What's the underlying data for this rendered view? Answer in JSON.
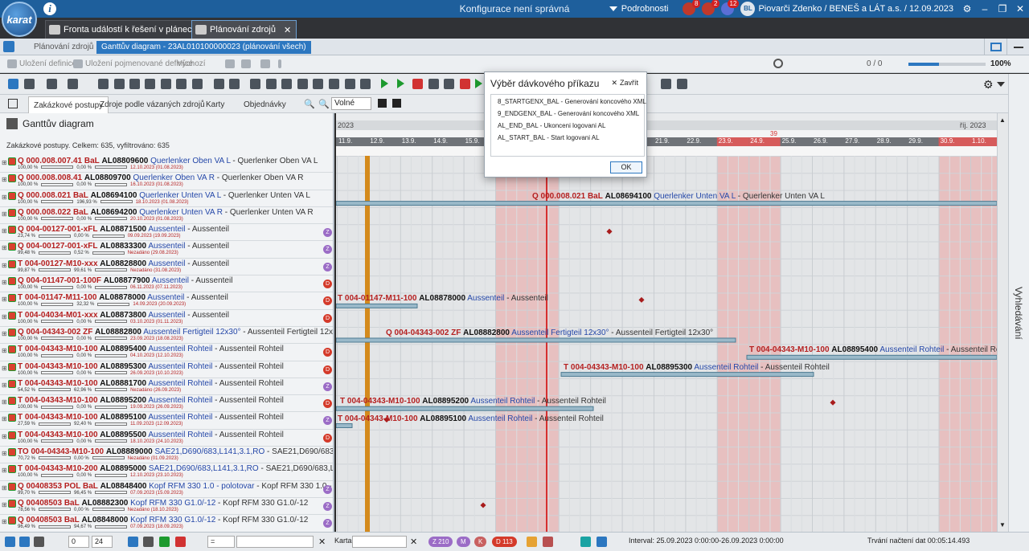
{
  "window": {
    "title": "Konfigurace není správná",
    "details_label": "Podrobnosti",
    "notifications": [
      {
        "count": "8",
        "color": "#c0392b"
      },
      {
        "count": "2",
        "color": "#c0392b"
      },
      {
        "count": "12",
        "color": "#5b6fd6"
      }
    ],
    "user_initials": "BL",
    "user_name": "Piovarči Zdenko / BENEŠ a LÁT a.s. / 12.09.2023",
    "logo_text": "karat"
  },
  "tabs": [
    {
      "label": "Fronta událostí k řešení v plánech - Firma"
    },
    {
      "label": "Plánování zdrojů"
    }
  ],
  "breadcrumb": {
    "items": [
      "Plánování zdrojů",
      "Ganttův diagram - 23AL010100000023 (plánování všech)"
    ]
  },
  "defbar": {
    "save_def": "Uložení definice",
    "save_named_def": "Uložení pojmenované definice",
    "default": "Výchozí",
    "counter": "0 / 0",
    "zoom": "100%"
  },
  "optrow": {
    "tabs": [
      "Zakázkové postupy",
      "Zdroje podle vázaných zdrojů",
      "Karty",
      "Objednávky"
    ],
    "zoom_mode": "Volné"
  },
  "left": {
    "title": "Ganttův diagram",
    "count_text": "Zakázkové postupy. Celkem: 635, vyfiltrováno: 635"
  },
  "rows": [
    {
      "code": "Q 000.008.007.41 BaL",
      "al": "AL08809600",
      "nm": "Querlenker Oben VA L",
      "ds": "Querlenker Oben VA L",
      "p1": "100,00 %",
      "p2": "0,00 %",
      "d": "12.10.2023 (01.08.2023)",
      "badge": ""
    },
    {
      "code": "Q 000.008.008.41",
      "al": "AL08809700",
      "nm": "Querlenker Oben VA R",
      "ds": "Querlenker Oben VA R",
      "p1": "100,00 %",
      "p2": "0,00 %",
      "d": "16.10.2023 (01.08.2023)",
      "badge": ""
    },
    {
      "code": "Q 000.008.021 BaL",
      "al": "AL08694100",
      "nm": "Querlenker Unten VA L",
      "ds": "Querlenker Unten VA L",
      "p1": "100,00 %",
      "p2": "196,93 %",
      "d": "18.10.2023 (01.08.2023)",
      "badge": ""
    },
    {
      "code": "Q 000.008.022 BaL",
      "al": "AL08694200",
      "nm": "Querlenker Unten VA R",
      "ds": "Querlenker Unten VA R",
      "p1": "100,00 %",
      "p2": "0,00 %",
      "d": "20.10.2023 (01.08.2023)",
      "badge": ""
    },
    {
      "code": "Q 004-00127-001-xFL",
      "al": "AL08871500",
      "nm": "Aussenteil",
      "ds": "Aussenteil",
      "p1": "23,74 %",
      "p2": "0,00 %",
      "d": "09.09.2023 (19.09.2023)",
      "badge": "Z"
    },
    {
      "code": "Q 004-00127-001-xFL",
      "al": "AL08833300",
      "nm": "Aussenteil",
      "ds": "Aussenteil",
      "p1": "99,48 %",
      "p2": "0,52 %",
      "d": "Nezadáno (29.08.2023)",
      "badge": "Z"
    },
    {
      "code": "T 004-00127-M10-xxx",
      "al": "AL08828800",
      "nm": "Aussenteil",
      "ds": "Aussenteil",
      "p1": "99,87 %",
      "p2": "99,61 %",
      "d": "Nezadáno (31.08.2023)",
      "badge": "Z"
    },
    {
      "code": "Q 004-01147-001-100F",
      "al": "AL08877900",
      "nm": "Aussenteil",
      "ds": "Aussenteil",
      "p1": "100,00 %",
      "p2": "0,00 %",
      "d": "06.11.2023 (07.11.2023)",
      "badge": "D"
    },
    {
      "code": "T 004-01147-M11-100",
      "al": "AL08878000",
      "nm": "Aussenteil",
      "ds": "Aussenteil",
      "p1": "100,00 %",
      "p2": "32,32 %",
      "d": "14.09.2023 (20.09.2023)",
      "badge": "D"
    },
    {
      "code": "T 004-04034-M01-xxx",
      "al": "AL08873800",
      "nm": "Aussenteil",
      "ds": "Aussenteil",
      "p1": "100,00 %",
      "p2": "0,00 %",
      "d": "03.10.2023 (01.11.2023)",
      "badge": "D"
    },
    {
      "code": "Q 004-04343-002 ZF",
      "al": "AL08882800",
      "nm": "Aussenteil Fertigteil 12x30°",
      "ds": "Aussenteil Fertigteil 12x30°",
      "p1": "100,00 %",
      "p2": "0,00 %",
      "d": "23.09.2023 (18.08.2023)",
      "badge": ""
    },
    {
      "code": "T 004-04343-M10-100",
      "al": "AL08895400",
      "nm": "Aussenteil Rohteil",
      "ds": "Aussenteil Rohteil",
      "p1": "100,00 %",
      "p2": "0,00 %",
      "d": "04.10.2023 (12.10.2023)",
      "badge": "D"
    },
    {
      "code": "T 004-04343-M10-100",
      "al": "AL08895300",
      "nm": "Aussenteil Rohteil",
      "ds": "Aussenteil Rohteil",
      "p1": "100,00 %",
      "p2": "0,00 %",
      "d": "26.09.2023 (10.10.2023)",
      "badge": "D"
    },
    {
      "code": "T 004-04343-M10-100",
      "al": "AL08881700",
      "nm": "Aussenteil Rohteil",
      "ds": "Aussenteil Rohteil",
      "p1": "54,52 %",
      "p2": "62,96 %",
      "d": "Nezadáno (26.09.2023)",
      "badge": "Z"
    },
    {
      "code": "T 004-04343-M10-100",
      "al": "AL08895200",
      "nm": "Aussenteil Rohteil",
      "ds": "Aussenteil Rohteil",
      "p1": "100,00 %",
      "p2": "0,00 %",
      "d": "19.09.2023 (26.09.2023)",
      "badge": "D"
    },
    {
      "code": "T 004-04343-M10-100",
      "al": "AL08895100",
      "nm": "Aussenteil Rohteil",
      "ds": "Aussenteil Rohteil",
      "p1": "27,59 %",
      "p2": "92,40 %",
      "d": "11.09.2023 (12.09.2023)",
      "badge": "Z"
    },
    {
      "code": "T 004-04343-M10-100",
      "al": "AL08895500",
      "nm": "Aussenteil Rohteil",
      "ds": "Aussenteil Rohteil",
      "p1": "100,00 %",
      "p2": "0,00 %",
      "d": "18.10.2023 (24.10.2023)",
      "badge": "D"
    },
    {
      "code": "TO 004-04343-M10-100",
      "al": "AL08889000",
      "nm": "SAE21,D690/683,L141,3.1,RO",
      "ds": "SAE21,D690/683,L141,3.1,RO",
      "p1": "70,72 %",
      "p2": "0,00 %",
      "d": "Nezadáno (01.09.2023)",
      "badge": ""
    },
    {
      "code": "T 004-04343-M10-200",
      "al": "AL08895000",
      "nm": "SAE21,D690/683,L141,3.1,RO",
      "ds": "SAE21,D690/683,L141,3.1,RO",
      "p1": "100,00 %",
      "p2": "0,00 %",
      "d": "12.10.2023 (23.10.2023)",
      "badge": ""
    },
    {
      "code": "Q 00408353 POL BaL",
      "al": "AL08848400",
      "nm": "Kopf RFM 330 1.0 - polotovar",
      "ds": "Kopf RFM 330 1.0 - polotovar",
      "p1": "99,70 %",
      "p2": "96,45 %",
      "d": "07.09.2023 (15.09.2023)",
      "badge": "Z"
    },
    {
      "code": "Q 00408503 BaL",
      "al": "AL08882300",
      "nm": "Kopf RFM 330 G1.0/-12",
      "ds": "Kopf RFM 330 G1.0/-12",
      "p1": "78,56 %",
      "p2": "0,00 %",
      "d": "Nezadáno (18.10.2023)",
      "badge": "Z"
    },
    {
      "code": "Q 00408503 BaL",
      "al": "AL08848000",
      "nm": "Kopf RFM 330 G1.0/-12",
      "ds": "Kopf RFM 330 G1.0/-12",
      "p1": "96,49 %",
      "p2": "94,67 %",
      "d": "07.09.2023 (18.09.2023)",
      "badge": "Z"
    }
  ],
  "gantt": {
    "year_labels": [
      "2023",
      "říj. 2023"
    ],
    "week_marker": "39",
    "day_labels": [
      "11.9.",
      "12.9.",
      "13.9.",
      "14.9.",
      "15.9.",
      "16.9.",
      "17.9.",
      "18.9.",
      "19.9.",
      "20.9.",
      "21.9.",
      "22.9.",
      "23.9.",
      "24.9.",
      "25.9.",
      "26.9.",
      "27.9.",
      "28.9.",
      "29.9.",
      "30.9.",
      "1.10."
    ],
    "bar_labels": [
      {
        "row": 2,
        "code": "Q 000.008.021 BaL",
        "al": "AL08694100",
        "nm": "Querlenker Unten VA L",
        "ds": "Querlenker Unten VA L"
      },
      {
        "row": 8,
        "code": "T 004-01147-M11-100",
        "al": "AL08878000",
        "nm": "Aussenteil",
        "ds": "Aussenteil"
      },
      {
        "row": 10,
        "code": "Q 004-04343-002 ZF",
        "al": "AL08882800",
        "nm": "Aussenteil Fertigteil 12x30°",
        "ds": "Aussenteil Fertigteil 12x30°"
      },
      {
        "row": 11,
        "code": "T 004-04343-M10-100",
        "al": "AL08895400",
        "nm": "Aussenteil Rohteil",
        "ds": "Aussenteil Rohteil"
      },
      {
        "row": 12,
        "code": "T 004-04343-M10-100",
        "al": "AL08895300",
        "nm": "Aussenteil Rohteil",
        "ds": "Aussenteil Rohteil"
      },
      {
        "row": 14,
        "code": "T 004-04343-M10-100",
        "al": "AL08895200",
        "nm": "Aussenteil Rohteil",
        "ds": "Aussenteil Rohteil"
      },
      {
        "row": 15,
        "code": "T 004-04343-M10-100",
        "al": "AL08895100",
        "nm": "Aussenteil Rohteil",
        "ds": "Aussenteil Rohteil"
      }
    ]
  },
  "sidebar_right_label": "Vyhledávání",
  "bottom": {
    "page_value": "0",
    "page_size": "24",
    "filter_value": "=",
    "karta_label": "Karta",
    "pills": [
      {
        "text": "Z 210",
        "color": "#9b6cc6"
      },
      {
        "text": "M",
        "color": "#9b6cc6"
      },
      {
        "text": "K",
        "color": "#c86060"
      },
      {
        "text": "D 113",
        "color": "#d43a2a"
      }
    ],
    "interval": "Interval: 25.09.2023 0:00:00-26.09.2023 0:00:00",
    "load_time": "Trvání načtení dat 00:05:14.493"
  },
  "modal": {
    "title": "Výběr dávkového příkazu",
    "close_label": "Zavřít",
    "items": [
      "8_STARTGENX_BAL - Generování koncového XML",
      "9_ENDGENX_BAL - Generování koncového XML",
      "AL_END_BAL - Ukonceni logovani AL",
      "AL_START_BAL - Start logovani AL"
    ],
    "ok_label": "OK"
  }
}
